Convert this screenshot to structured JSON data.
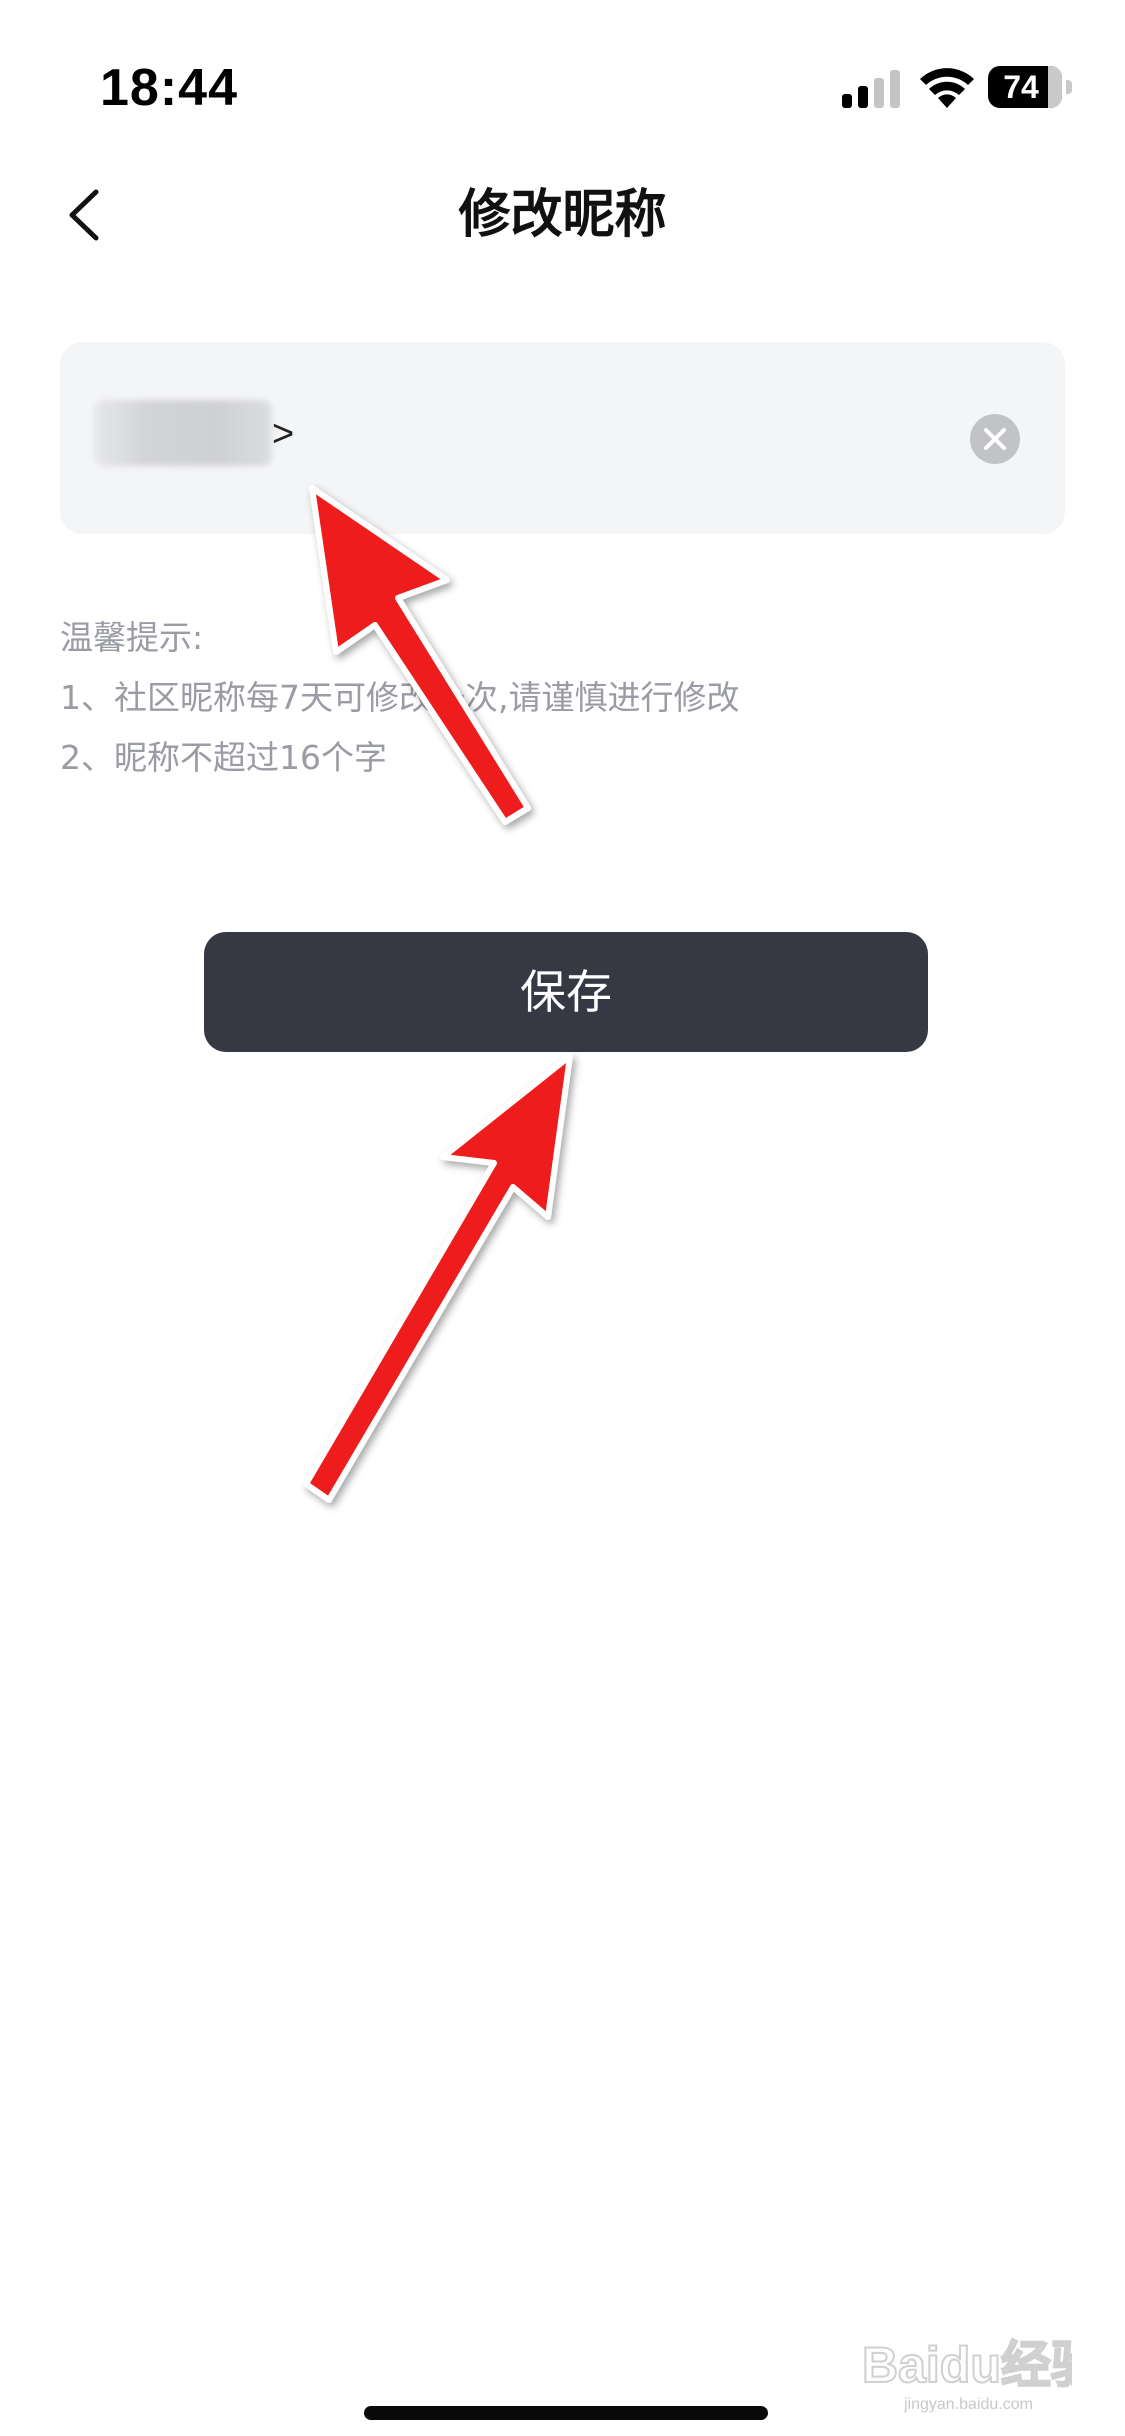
{
  "status_bar": {
    "time": "18:44",
    "battery_level": "74",
    "icons": [
      "signal-icon",
      "wifi-icon",
      "battery-icon"
    ]
  },
  "nav": {
    "title": "修改昵称",
    "back_icon": "chevron-left-icon"
  },
  "nickname_input": {
    "value_suffix": ">",
    "clear_icon": "clear-circle-icon"
  },
  "tips": {
    "heading": "温馨提示:",
    "items": [
      "1、社区昵称每7天可修改一次,请谨慎进行修改",
      "2、昵称不超过16个字"
    ]
  },
  "save_button": {
    "label": "保存"
  },
  "annotations": {
    "arrow_color": "#ee1c1c",
    "arrows": [
      "arrow-to-nickname-input",
      "arrow-to-save-button"
    ]
  },
  "watermark": {
    "text": "Baidu经验",
    "subtext": "jingyan.baidu.com"
  },
  "colors": {
    "save_button_bg": "#363843",
    "input_bg": "#f4f5f7",
    "tips_text": "#9a9ca3"
  }
}
